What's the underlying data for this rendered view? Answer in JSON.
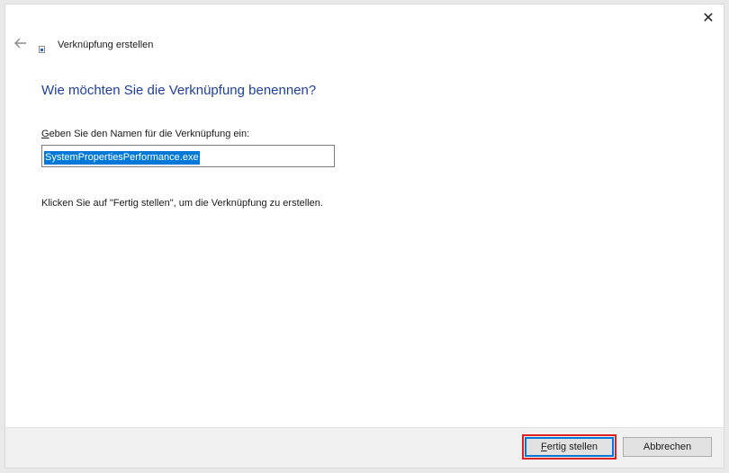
{
  "window": {
    "title": "Verknüpfung erstellen",
    "close_glyph": "✕"
  },
  "main": {
    "heading": "Wie möchten Sie die Verknüpfung benennen?",
    "field_label_access_key": "G",
    "field_label_rest": "eben Sie den Namen für die Verknüpfung ein:",
    "name_value": "SystemPropertiesPerformance.exe",
    "hint": "Klicken Sie auf \"Fertig stellen\", um die Verknüpfung zu erstellen."
  },
  "footer": {
    "finish_access_key": "F",
    "finish_rest": "ertig stellen",
    "cancel_label": "Abbrechen"
  },
  "colors": {
    "heading": "#1e3f9c",
    "selection": "#0078d7",
    "highlight_outline": "#e02020"
  },
  "icons": {
    "back": "arrow-left-icon",
    "close": "close-icon",
    "title": "shortcut-icon"
  }
}
